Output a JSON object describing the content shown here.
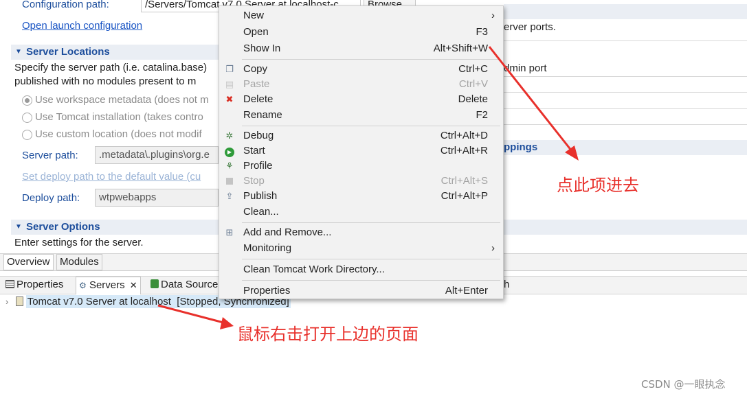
{
  "editor": {
    "config_path_label": "Configuration path:",
    "config_path_value": "/Servers/Tomcat v7.0 Server at localhost-c",
    "browse_label": "Browse...",
    "open_launch_link": "Open launch configuration",
    "right_server_ports_text": "erver ports.",
    "right_admin_port_text": "dmin port",
    "right_mime_mappings_text": "ppings"
  },
  "server_locations": {
    "title": "Server Locations",
    "desc_line1": "Specify the server path (i.e. catalina.base)",
    "desc_line2": "published with no modules present to m",
    "radio_workspace": "Use workspace metadata (does not m",
    "radio_tomcat": "Use Tomcat installation (takes contro",
    "radio_custom": "Use custom location (does not modif",
    "server_path_label": "Server path:",
    "server_path_value": ".metadata\\.plugins\\org.e",
    "set_deploy_link": "Set deploy path to the default value (cu",
    "deploy_path_label": "Deploy path:",
    "deploy_path_value": "wtpwebapps"
  },
  "server_options": {
    "title": "Server Options",
    "desc": "Enter settings for the server."
  },
  "editor_tabs": [
    "Overview",
    "Modules"
  ],
  "view_tabs": {
    "properties": "Properties",
    "servers": "Servers",
    "data_source": "Data Source",
    "trailing": "h"
  },
  "server_row": {
    "name": "Tomcat v7.0 Server at localhost",
    "status": "[Stopped, Synchronized]"
  },
  "context_menu": {
    "new": {
      "label": "New"
    },
    "open": {
      "label": "Open",
      "shortcut": "F3"
    },
    "show_in": {
      "label": "Show In",
      "shortcut": "Alt+Shift+W"
    },
    "copy": {
      "label": "Copy",
      "shortcut": "Ctrl+C"
    },
    "paste": {
      "label": "Paste",
      "shortcut": "Ctrl+V"
    },
    "delete": {
      "label": "Delete",
      "shortcut": "Delete"
    },
    "rename": {
      "label": "Rename",
      "shortcut": "F2"
    },
    "debug": {
      "label": "Debug",
      "shortcut": "Ctrl+Alt+D"
    },
    "start": {
      "label": "Start",
      "shortcut": "Ctrl+Alt+R"
    },
    "profile": {
      "label": "Profile"
    },
    "stop": {
      "label": "Stop",
      "shortcut": "Ctrl+Alt+S"
    },
    "publish": {
      "label": "Publish",
      "shortcut": "Ctrl+Alt+P"
    },
    "clean": {
      "label": "Clean..."
    },
    "add_remove": {
      "label": "Add and Remove..."
    },
    "monitoring": {
      "label": "Monitoring"
    },
    "clean_tomcat": {
      "label": "Clean Tomcat Work Directory..."
    },
    "properties": {
      "label": "Properties",
      "shortcut": "Alt+Enter"
    }
  },
  "annotations": {
    "click_here": "点此项进去",
    "right_click": "鼠标右击打开上边的页面",
    "watermark": "CSDN @一眼执念"
  },
  "colors": {
    "annotation_red": "#e8302b",
    "section_header_blue": "#1d4e9c",
    "link_blue": "#1a55c4"
  }
}
